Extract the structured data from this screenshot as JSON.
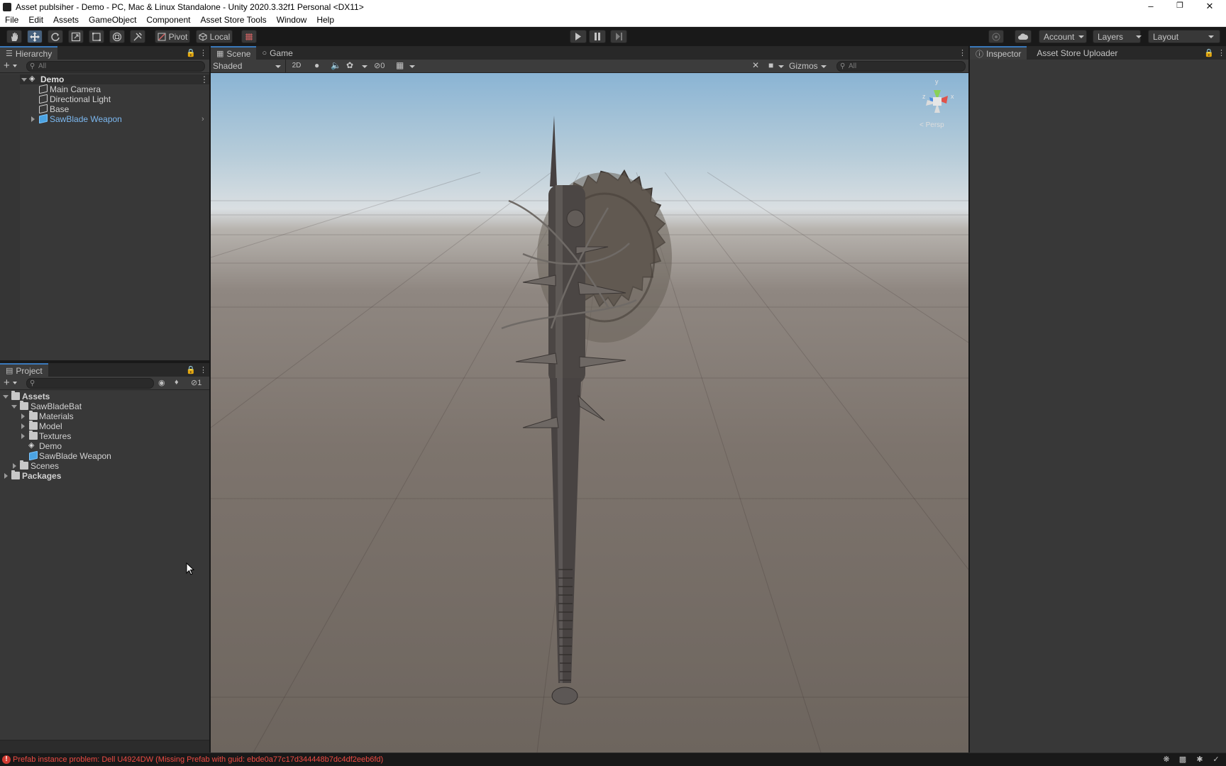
{
  "window": {
    "title": "Asset publsiher - Demo - PC, Mac & Linux Standalone - Unity 2020.3.32f1 Personal <DX11>",
    "controls": [
      "–",
      "❐",
      "✕"
    ]
  },
  "menu": [
    "File",
    "Edit",
    "Assets",
    "GameObject",
    "Component",
    "Asset Store Tools",
    "Window",
    "Help"
  ],
  "toolbar": {
    "pivot_label": "Pivot",
    "local_label": "Local",
    "account_label": "Account",
    "layers_label": "Layers",
    "layout_label": "Layout"
  },
  "hierarchy": {
    "tab_label": "Hierarchy",
    "search_placeholder": "All",
    "scene_name": "Demo",
    "items": [
      "Main Camera",
      "Directional Light",
      "Base",
      "SawBlade Weapon"
    ]
  },
  "project": {
    "tab_label": "Project",
    "hidden_count": "1",
    "tree": {
      "assets": "Assets",
      "sawbladebat": "SawBladeBat",
      "materials": "Materials",
      "model": "Model",
      "textures": "Textures",
      "demo": "Demo",
      "prefab": "SawBlade Weapon",
      "scenes": "Scenes",
      "packages": "Packages"
    }
  },
  "scene": {
    "tabs": [
      "Scene",
      "Game"
    ],
    "shading_mode": "Shaded",
    "mode_2d": "2D",
    "hidden_count": "0",
    "gizmos_label": "Gizmos",
    "search_placeholder": "All",
    "gizmo_axes": {
      "y": "y",
      "x": "x",
      "z": "z"
    },
    "persp_label": "< Persp"
  },
  "inspector": {
    "tabs": [
      "Inspector",
      "Asset Store Uploader"
    ]
  },
  "status": {
    "message": "Prefab instance problem: Dell U4924DW (Missing Prefab with guid: ebde0a77c17d344448b7dc4df2eeb6fd)",
    "error_color": "#ef4b43"
  },
  "colors": {
    "accent": "#3a79bb",
    "prefab_text": "#7cb8f0",
    "panel_bg": "#383838",
    "toolbar_bg": "#191919"
  }
}
